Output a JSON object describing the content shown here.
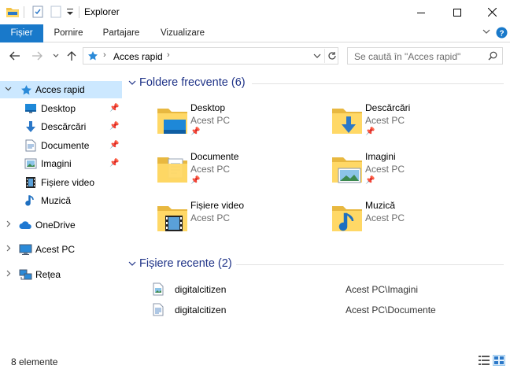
{
  "window": {
    "title": "Explorer",
    "minimize_icon": "minimize-icon",
    "maximize_icon": "maximize-icon",
    "close_icon": "close-icon"
  },
  "ribbon": {
    "tabs": [
      {
        "label": "Fișier",
        "active": true
      },
      {
        "label": "Pornire"
      },
      {
        "label": "Partajare"
      },
      {
        "label": "Vizualizare"
      }
    ],
    "accent": "#1979ca"
  },
  "nav": {
    "address_root_icon": "star-icon",
    "address_path": "Acces rapid",
    "search_placeholder": "Se caută în \"Acces rapid\""
  },
  "sidebar": {
    "items": [
      {
        "label": "Acces rapid",
        "icon": "star-icon",
        "selected": true,
        "expanded": true
      },
      {
        "label": "Desktop",
        "icon": "desktop-icon",
        "pinned": true
      },
      {
        "label": "Descărcări",
        "icon": "download-icon",
        "pinned": true
      },
      {
        "label": "Documente",
        "icon": "document-icon",
        "pinned": true
      },
      {
        "label": "Imagini",
        "icon": "pictures-icon",
        "pinned": true
      },
      {
        "label": "Fișiere video",
        "icon": "video-icon"
      },
      {
        "label": "Muzică",
        "icon": "music-icon"
      },
      {
        "label": "OneDrive",
        "icon": "cloud-icon"
      },
      {
        "label": "Acest PC",
        "icon": "computer-icon"
      },
      {
        "label": "Rețea",
        "icon": "network-icon"
      }
    ]
  },
  "main": {
    "frequent_header": "Foldere frecvente (6)",
    "frequent": [
      {
        "name": "Desktop",
        "location": "Acest PC",
        "pinned": true,
        "icon": "desktop-folder-icon"
      },
      {
        "name": "Descărcări",
        "location": "Acest PC",
        "pinned": true,
        "icon": "downloads-folder-icon"
      },
      {
        "name": "Documente",
        "location": "Acest PC",
        "pinned": true,
        "icon": "documents-folder-icon"
      },
      {
        "name": "Imagini",
        "location": "Acest PC",
        "pinned": true,
        "icon": "pictures-folder-icon"
      },
      {
        "name": "Fișiere video",
        "location": "Acest PC",
        "pinned": false,
        "icon": "videos-folder-icon"
      },
      {
        "name": "Muzică",
        "location": "Acest PC",
        "pinned": false,
        "icon": "music-folder-icon"
      }
    ],
    "recent_header": "Fișiere recente (2)",
    "recent": [
      {
        "name": "digitalcitizen",
        "path": "Acest PC\\Imagini",
        "icon": "image-file-icon"
      },
      {
        "name": "digitalcitizen",
        "path": "Acest PC\\Documente",
        "icon": "text-file-icon"
      }
    ]
  },
  "status": {
    "item_count": "8 elemente"
  }
}
